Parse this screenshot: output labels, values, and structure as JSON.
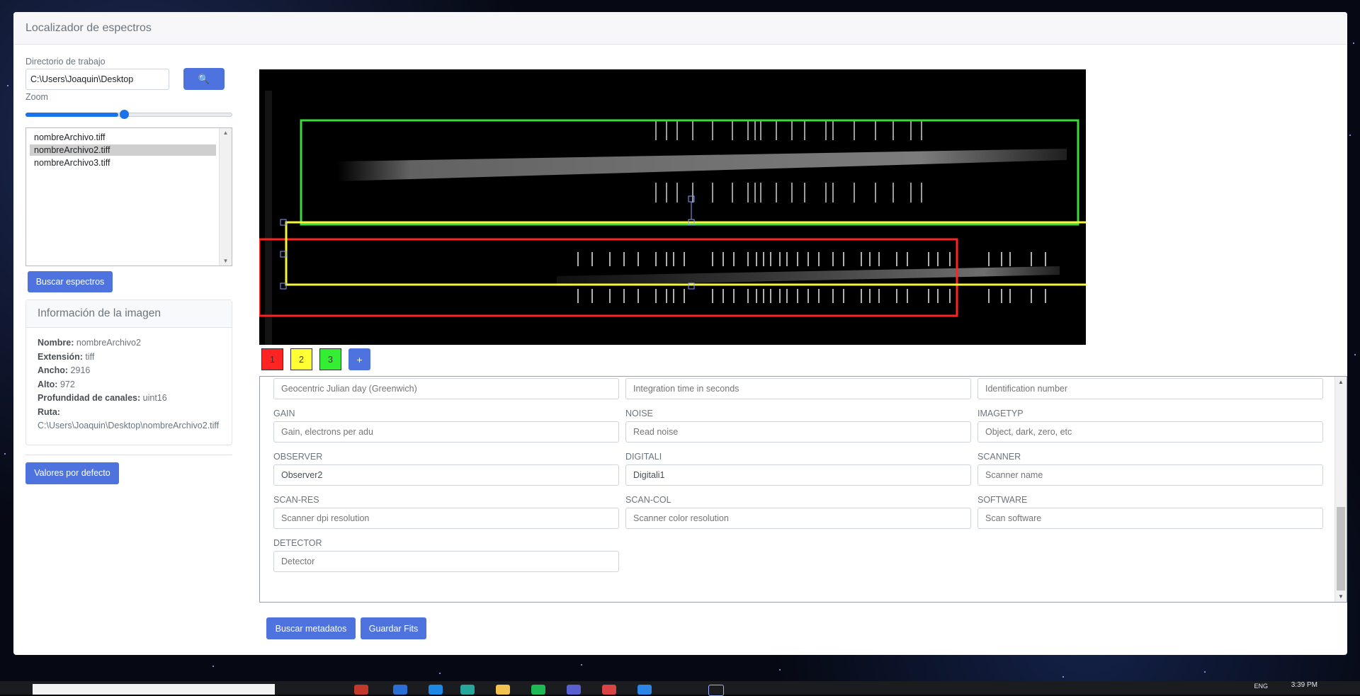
{
  "app": {
    "title": "Localizador de espectros"
  },
  "workdir": {
    "label": "Directorio de trabajo",
    "value": "C:\\Users\\Joaquin\\Desktop",
    "search_icon": "🔍"
  },
  "zoom": {
    "label": "Zoom",
    "level": 0.45
  },
  "files": [
    "nombreArchivo.tiff",
    "nombreArchivo2.tiff",
    "nombreArchivo3.tiff"
  ],
  "selected_file_index": 1,
  "buttons": {
    "find_spectra": "Buscar espectros",
    "defaults": "Valores por defecto",
    "find_metadata": "Buscar metadatos",
    "save_fits": "Guardar Fits"
  },
  "image_info": {
    "title": "Información de la imagen",
    "name_label": "Nombre:",
    "name": "nombreArchivo2",
    "ext_label": "Extensión:",
    "ext": "tiff",
    "width_label": "Ancho:",
    "width": "2916",
    "height_label": "Alto:",
    "height": "972",
    "depth_label": "Profundidad de canales:",
    "depth": "uint16",
    "path_label": "Ruta:",
    "path": "C:\\Users\\Joaquin\\Desktop\\nombreArchivo2.tiff"
  },
  "regions": [
    {
      "label": "1",
      "color": "#ff2424"
    },
    {
      "label": "2",
      "color": "#ffff33"
    },
    {
      "label": "3",
      "color": "#33ee33"
    }
  ],
  "add_region": "+",
  "metadata_rows": [
    [
      {
        "label": "",
        "placeholder": "Geocentric Julian day (Greenwich)",
        "value": ""
      },
      {
        "label": "",
        "placeholder": "Integration time in seconds",
        "value": ""
      },
      {
        "label": "",
        "placeholder": "Identification number",
        "value": ""
      }
    ],
    [
      {
        "label": "GAIN",
        "placeholder": "Gain, electrons per adu",
        "value": ""
      },
      {
        "label": "NOISE",
        "placeholder": "Read noise",
        "value": ""
      },
      {
        "label": "IMAGETYP",
        "placeholder": "Object, dark, zero, etc",
        "value": ""
      }
    ],
    [
      {
        "label": "OBSERVER",
        "placeholder": "",
        "value": "Observer2"
      },
      {
        "label": "DIGITALI",
        "placeholder": "",
        "value": "Digitali1"
      },
      {
        "label": "SCANNER",
        "placeholder": "Scanner name",
        "value": ""
      }
    ],
    [
      {
        "label": "SCAN-RES",
        "placeholder": "Scanner dpi resolution",
        "value": ""
      },
      {
        "label": "SCAN-COL",
        "placeholder": "Scanner color resolution",
        "value": ""
      },
      {
        "label": "SOFTWARE",
        "placeholder": "Scan software",
        "value": ""
      }
    ],
    [
      {
        "label": "DETECTOR",
        "placeholder": "Detector",
        "value": ""
      }
    ]
  ],
  "taskbar": {
    "lang": "ENG",
    "time": "3:39 PM"
  }
}
